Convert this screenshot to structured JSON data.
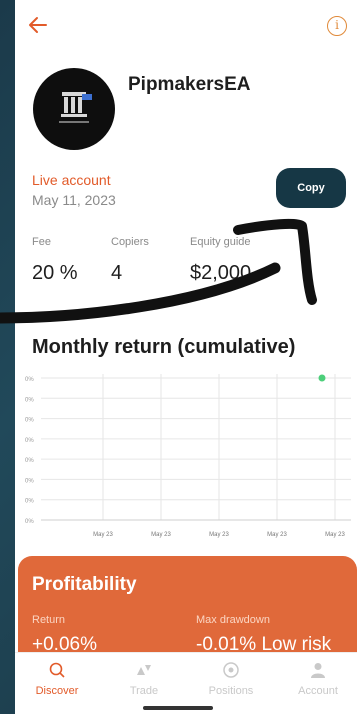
{
  "header": {
    "back_icon": "arrow-left-icon",
    "info_icon": "info-icon",
    "info_glyph": "i"
  },
  "profile": {
    "name": "PipmakersEA",
    "account_type": "Live account",
    "date": "May 11, 2023",
    "copy_label": "Copy"
  },
  "stats": [
    {
      "label": "Fee",
      "value": "20 %"
    },
    {
      "label": "Copiers",
      "value": "4"
    },
    {
      "label": "Equity guide",
      "value": "$2,000"
    }
  ],
  "monthly": {
    "title": "Monthly return (cumulative)"
  },
  "chart_data": {
    "type": "line",
    "title": "",
    "x": [
      "May 23",
      "May 23",
      "May 23",
      "May 23",
      "May 23"
    ],
    "y_ticks": [
      "0%",
      "0%",
      "0%",
      "0%",
      "0%",
      "0%",
      "0%",
      "0%"
    ],
    "series": [
      {
        "values": [
          0.06
        ],
        "color": "#4ccf7a"
      }
    ],
    "grid": true
  },
  "profitability": {
    "title": "Profitability",
    "return_label": "Return",
    "return_value": "+0.06%",
    "drawdown_label": "Max drawdown",
    "drawdown_value": "-0.01% Low risk"
  },
  "nav": [
    {
      "label": "Discover",
      "icon": "search-icon",
      "glyph": "○",
      "active": true
    },
    {
      "label": "Trade",
      "icon": "trade-icon",
      "glyph": "▲▼",
      "active": false
    },
    {
      "label": "Positions",
      "icon": "positions-icon",
      "glyph": "◉",
      "active": false
    },
    {
      "label": "Account",
      "icon": "account-icon",
      "glyph": "●",
      "active": false
    }
  ],
  "colors": {
    "accent": "#e25b2a",
    "copy_button": "#163745",
    "card": "#e0693a"
  }
}
